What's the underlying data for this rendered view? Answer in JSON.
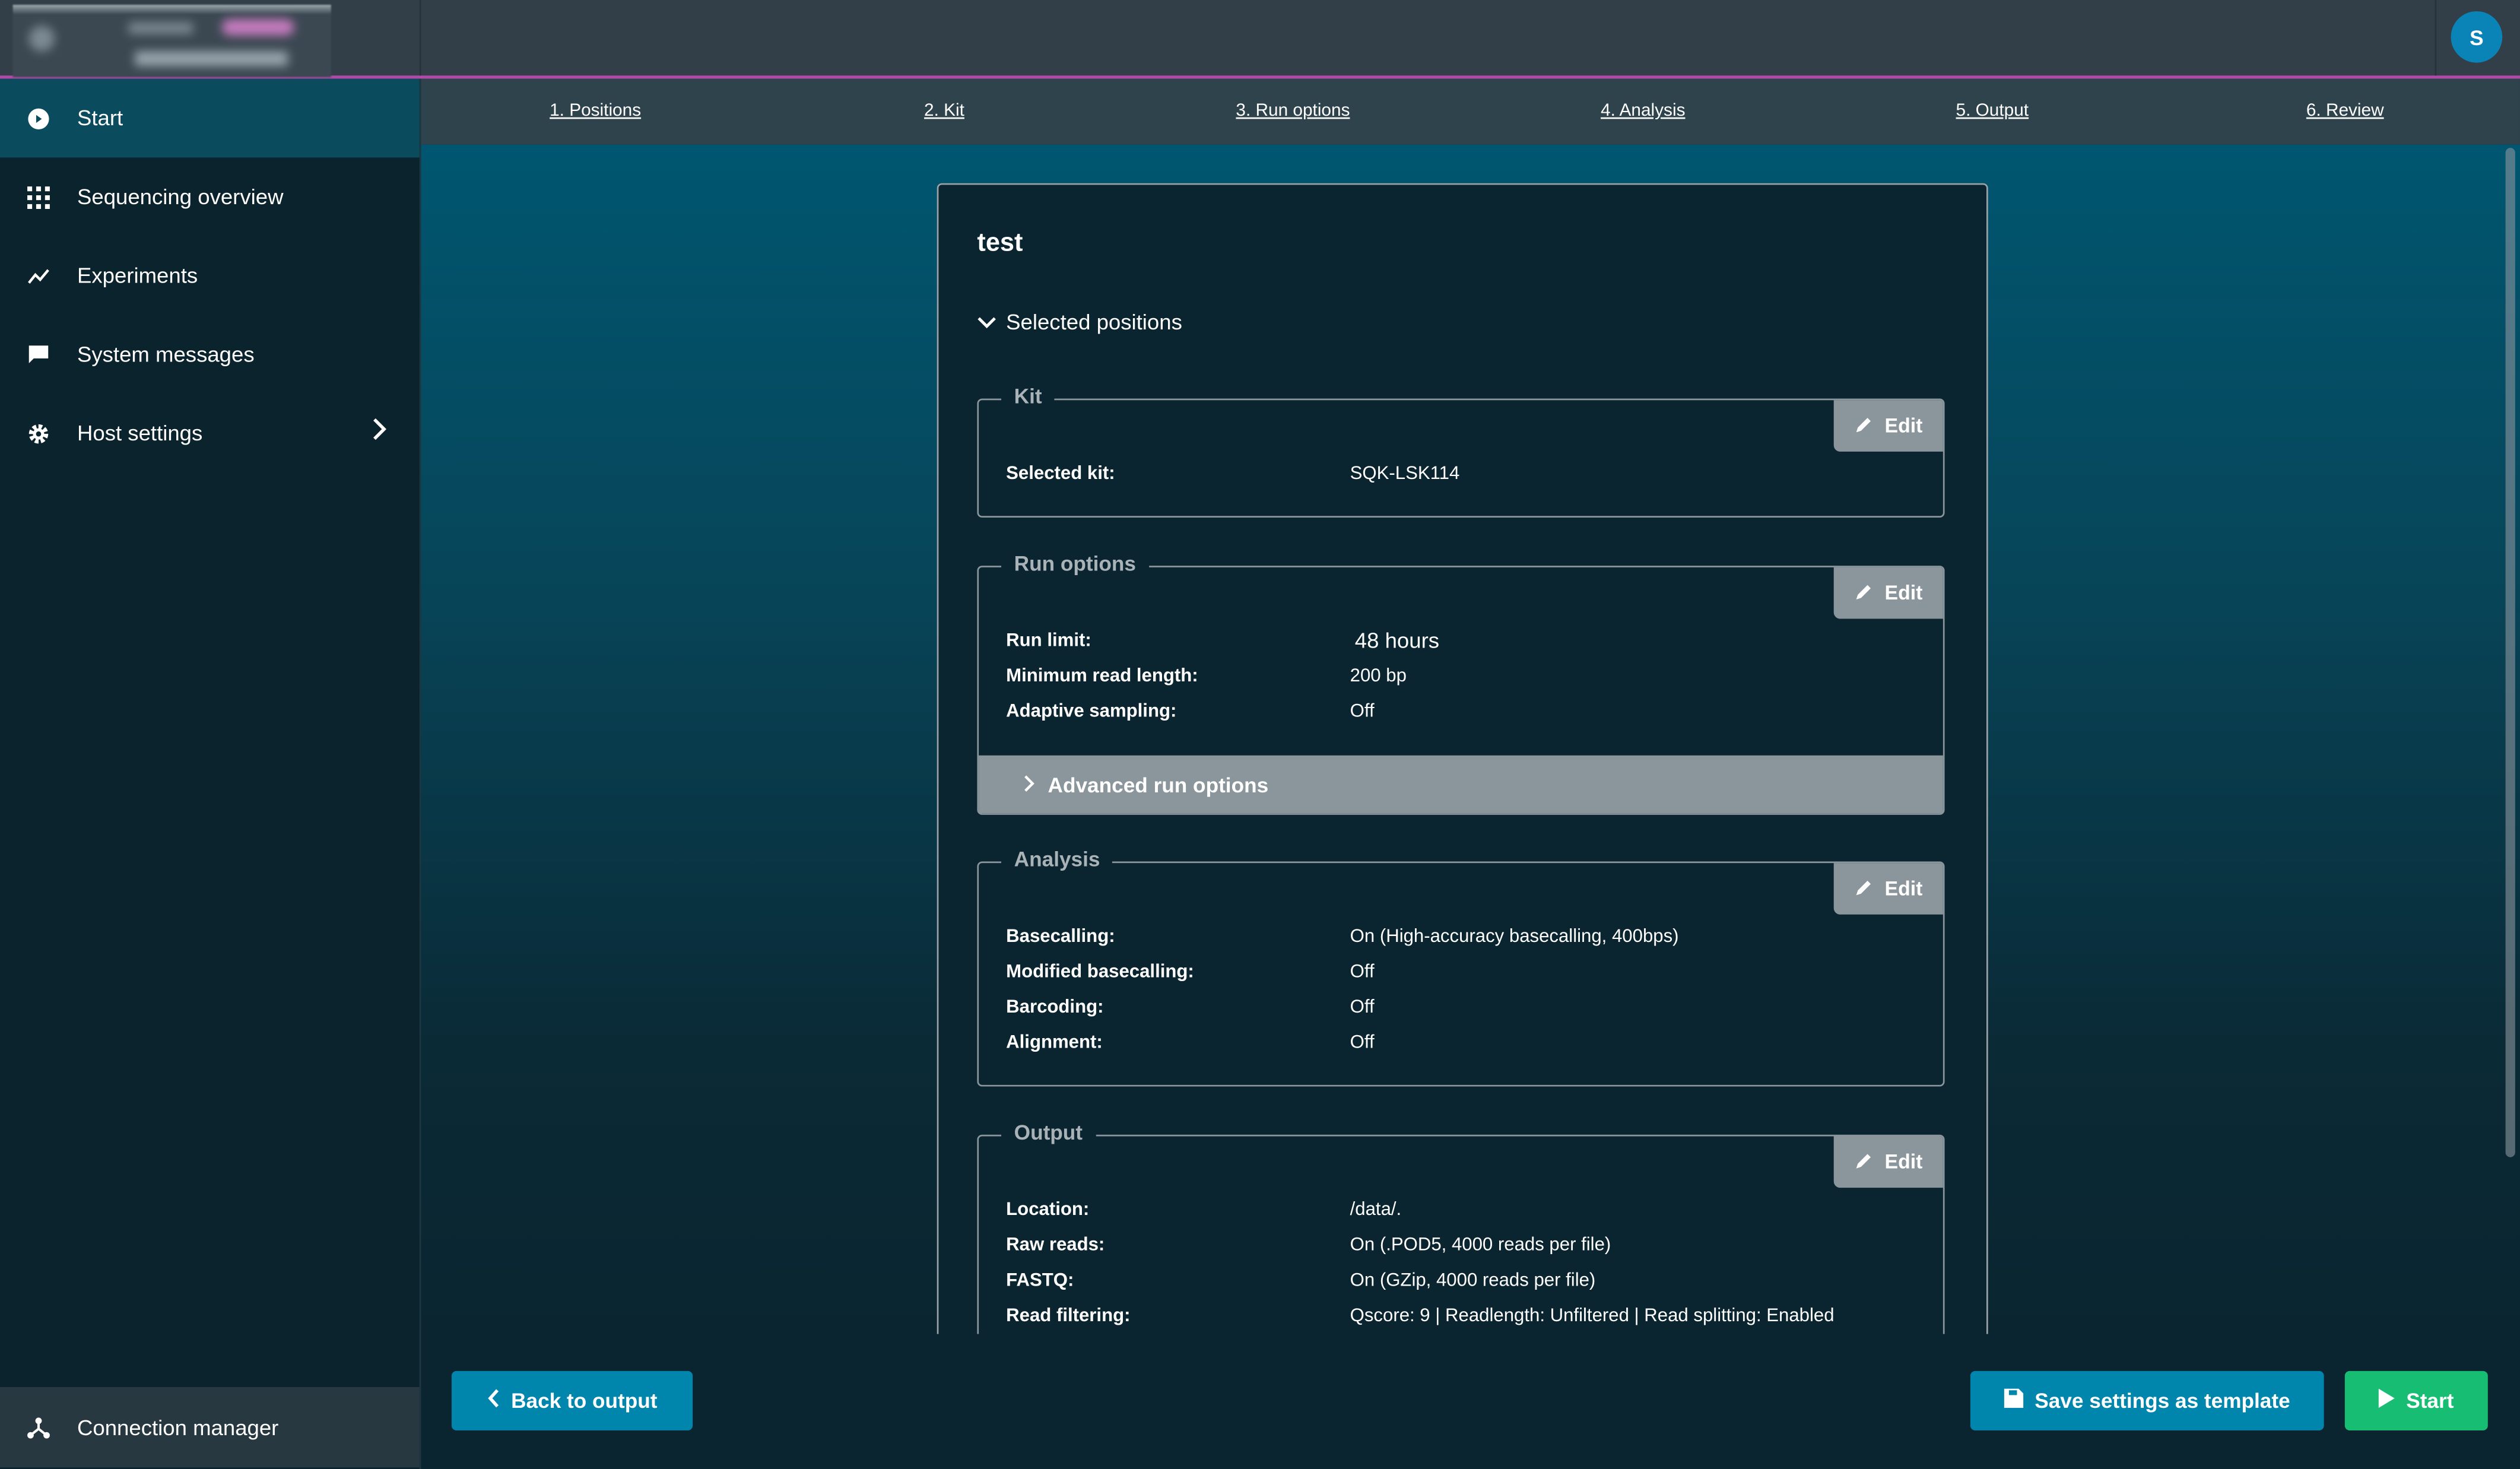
{
  "header": {
    "user_initial": "S"
  },
  "sidebar": {
    "items": [
      {
        "label": "Start",
        "icon": "play-circle-icon",
        "active": true
      },
      {
        "label": "Sequencing overview",
        "icon": "grid-icon"
      },
      {
        "label": "Experiments",
        "icon": "chart-line-icon"
      },
      {
        "label": "System messages",
        "icon": "message-icon"
      },
      {
        "label": "Host settings",
        "icon": "gear-icon"
      }
    ],
    "connection_manager": "Connection manager"
  },
  "steps": [
    "1. Positions",
    "2. Kit",
    "3. Run options",
    "4. Analysis",
    "5. Output",
    "6. Review"
  ],
  "card": {
    "title": "test",
    "selected_positions": "Selected positions",
    "edit_label": "Edit",
    "kit": {
      "legend": "Kit",
      "rows": [
        [
          "Selected kit:",
          "SQK-LSK114"
        ]
      ]
    },
    "run_options": {
      "legend": "Run options",
      "rows": [
        [
          "Run limit:",
          "48 hours"
        ],
        [
          "Minimum read length:",
          "200 bp"
        ],
        [
          "Adaptive sampling:",
          "Off"
        ]
      ],
      "advanced": "Advanced run options"
    },
    "analysis": {
      "legend": "Analysis",
      "rows": [
        [
          "Basecalling:",
          "On (High-accuracy basecalling, 400bps)"
        ],
        [
          "Modified basecalling:",
          "Off"
        ],
        [
          "Barcoding:",
          "Off"
        ],
        [
          "Alignment:",
          "Off"
        ]
      ]
    },
    "output": {
      "legend": "Output",
      "rows": [
        [
          "Location:",
          "/data/."
        ],
        [
          "Raw reads:",
          "On (.POD5, 4000 reads per file)"
        ],
        [
          "FASTQ:",
          "On (GZip, 4000 reads per file)"
        ],
        [
          "Read filtering:",
          "Qscore: 9 | Readlength: Unfiltered | Read splitting: Enabled"
        ]
      ]
    }
  },
  "footer": {
    "back": "Back to output",
    "save_template": "Save settings as template",
    "start": "Start"
  },
  "colors": {
    "accent": "#0085ad",
    "start": "#17bd73",
    "highlight": "#b04aa8",
    "active_nav": "#0a4c5e"
  }
}
